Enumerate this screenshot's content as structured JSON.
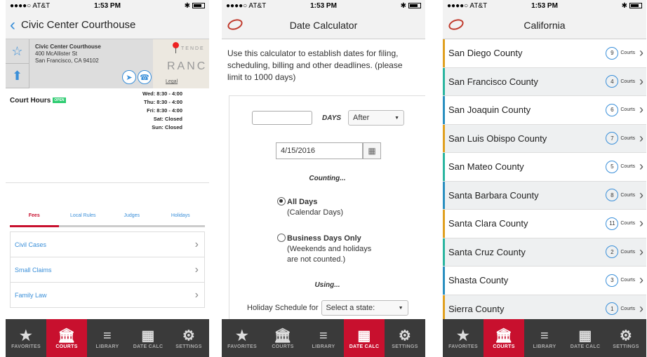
{
  "colors": {
    "accent_red": "#c8102e",
    "link_blue": "#3a8fd9",
    "tabbar": "#3a3a3a"
  },
  "status": {
    "carrier": "●●●●○ AT&T",
    "time": "1:53 PM",
    "bt": "✱"
  },
  "tabbar": [
    {
      "label": "FAVORITES",
      "icon": "star-icon"
    },
    {
      "label": "COURTS",
      "icon": "courthouse-icon"
    },
    {
      "label": "LIBRARY",
      "icon": "books-icon"
    },
    {
      "label": "DATE CALC",
      "icon": "calendar-icon"
    },
    {
      "label": "SETTINGS",
      "icon": "gear-icon"
    }
  ],
  "screen1": {
    "title": "Civic Center Courthouse",
    "address_name": "Civic Center Courthouse",
    "address_line1": "400 McAllister St",
    "address_line2": "San Francisco, CA 94102",
    "map_word": "RANC",
    "map_word_small": "TENDE",
    "legal": "Legal",
    "court_hours_label": "Court Hours",
    "open_badge": "OPEN",
    "schedule": [
      "Wed: 8:30 - 4:00",
      "Thu: 8:30 - 4:00",
      "Fri: 8:30 - 4:00",
      "Sat: Closed",
      "Sun: Closed"
    ],
    "subtabs": [
      "Fees",
      "Local Rules",
      "Judges",
      "Holidays"
    ],
    "fee_items": [
      "Civil Cases",
      "Small Claims",
      "Family Law"
    ]
  },
  "screen2": {
    "title": "Date Calculator",
    "intro": "Use this calculator to establish dates for filing, scheduling, billing and other deadlines. (please limit to 1000 days)",
    "days_label": "DAYS",
    "direction_value": "After",
    "date_value": "4/15/2016",
    "counting_label": "Counting...",
    "opt1_title": "All Days",
    "opt1_sub": "(Calendar Days)",
    "opt2_title": "Business Days Only",
    "opt2_sub1": "(Weekends and holidays",
    "opt2_sub2": "are not counted.)",
    "using_label": "Using...",
    "holiday_label": "Holiday Schedule for",
    "holiday_placeholder": "Select a state:"
  },
  "screen3": {
    "title": "California",
    "courts_word": "Courts",
    "counties": [
      {
        "name": "San Diego County",
        "count": "9",
        "bar": "#e0a020"
      },
      {
        "name": "San Francisco County",
        "count": "4",
        "bar": "#2bb5a0"
      },
      {
        "name": "San Joaquin County",
        "count": "6",
        "bar": "#2a8fc0"
      },
      {
        "name": "San Luis Obispo County",
        "count": "7",
        "bar": "#e0a020"
      },
      {
        "name": "San Mateo County",
        "count": "5",
        "bar": "#2bb5a0"
      },
      {
        "name": "Santa Barbara County",
        "count": "8",
        "bar": "#2a8fc0"
      },
      {
        "name": "Santa Clara County",
        "count": "11",
        "bar": "#e0a020"
      },
      {
        "name": "Santa Cruz County",
        "count": "2",
        "bar": "#2bb5a0"
      },
      {
        "name": "Shasta County",
        "count": "3",
        "bar": "#2a8fc0"
      },
      {
        "name": "Sierra County",
        "count": "1",
        "bar": "#e0a020"
      }
    ]
  }
}
